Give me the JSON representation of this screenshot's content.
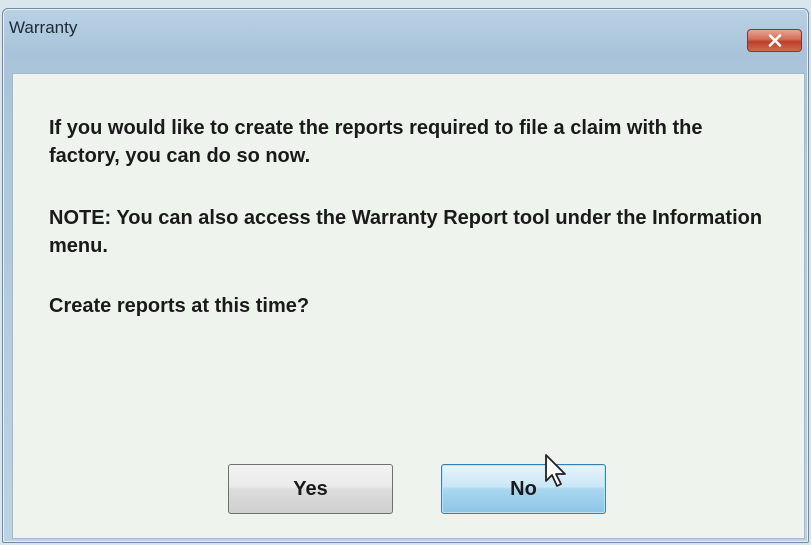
{
  "window": {
    "title": "Warranty"
  },
  "message": {
    "line1": "If you would like to create the reports required to file a claim with the factory, you can do so now.",
    "line2": "NOTE: You can also access the Warranty Report tool under the Information menu.",
    "line3": "Create reports at this time?"
  },
  "buttons": {
    "yes_label": "Yes",
    "no_label": "No"
  },
  "icons": {
    "close": "close-icon",
    "cursor": "mouse-pointer-icon"
  },
  "colors": {
    "close_button": "#c8503a",
    "focused_button": "#a9d7f0"
  }
}
